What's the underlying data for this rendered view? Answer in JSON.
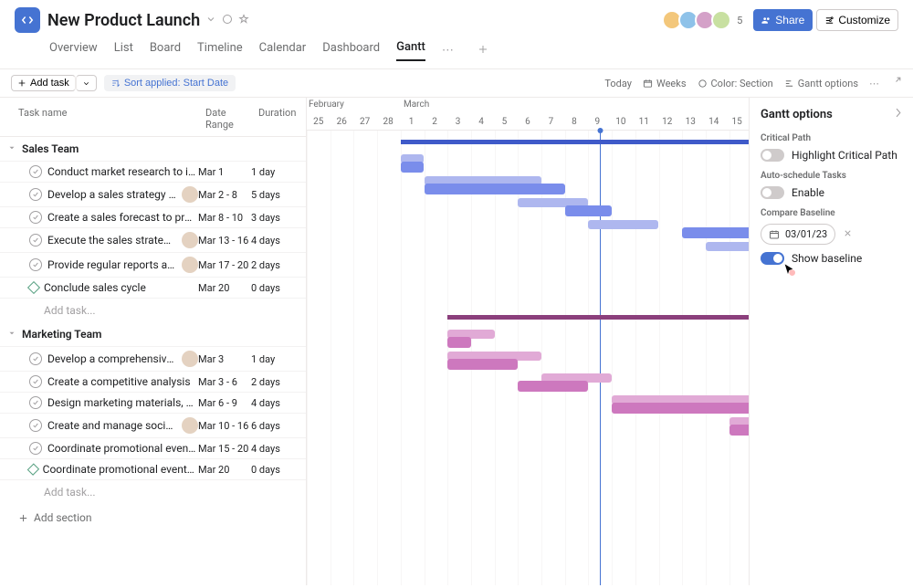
{
  "header": {
    "title": "New Product Launch",
    "share_label": "Share",
    "customize_label": "Customize",
    "avatar_extra": "5"
  },
  "nav": {
    "items": [
      "Overview",
      "List",
      "Board",
      "Timeline",
      "Calendar",
      "Dashboard",
      "Gantt"
    ],
    "active_index": 6
  },
  "toolbar": {
    "add_task": "Add task",
    "sort_label": "Sort applied: Start Date",
    "today": "Today",
    "weeks": "Weeks",
    "color": "Color: Section",
    "gantt_options": "Gantt options"
  },
  "columns": {
    "task": "Task name",
    "date": "Date Range",
    "duration": "Duration"
  },
  "timeline": {
    "months": [
      {
        "label": "February",
        "pos": 2
      },
      {
        "label": "March",
        "pos": 106
      }
    ],
    "days": [
      "25",
      "26",
      "27",
      "28",
      "1",
      "2",
      "3",
      "4",
      "5",
      "6",
      "7",
      "8",
      "9",
      "10",
      "11",
      "12",
      "13",
      "14",
      "15"
    ],
    "cell_width": 25.7,
    "today_index": 12.5
  },
  "sections": [
    {
      "name": "Sales Team",
      "color": "sales",
      "section_bar_start": 4,
      "section_bar_end": 25,
      "tasks": [
        {
          "name": "Conduct market research to identify...",
          "date": "Mar 1",
          "dur": "1 day",
          "avatar": false,
          "bar_start": 4,
          "bar_end": 5,
          "base_start": 4,
          "base_end": 5
        },
        {
          "name": "Develop a sales strategy that...",
          "date": "Mar 2 - 8",
          "dur": "5 days",
          "avatar": true,
          "bar_start": 5,
          "bar_end": 11,
          "base_start": 5,
          "base_end": 10
        },
        {
          "name": "Create a sales forecast to project...",
          "date": "Mar 8 - 10",
          "dur": "3 days",
          "avatar": false,
          "bar_start": 11,
          "bar_end": 13,
          "base_start": 9,
          "base_end": 12
        },
        {
          "name": "Execute the sales strategy by...",
          "date": "Mar 13 - 16",
          "dur": "4 days",
          "avatar": true,
          "bar_start": 16,
          "bar_end": 19,
          "base_start": 12,
          "base_end": 15
        },
        {
          "name": "Provide regular reports and...",
          "date": "Mar 17 - 20",
          "dur": "2 days",
          "avatar": true,
          "bar_start": 20,
          "bar_end": 22,
          "base_start": 17,
          "base_end": 19
        },
        {
          "name": "Conclude sales cycle",
          "date": "Mar 20",
          "dur": "0 days",
          "avatar": false,
          "milestone": true
        }
      ],
      "add_label": "Add task..."
    },
    {
      "name": "Marketing Team",
      "color": "mkt",
      "section_bar_start": 6,
      "section_bar_end": 25,
      "tasks": [
        {
          "name": "Develop a comprehensive...",
          "date": "Mar 3",
          "dur": "1 day",
          "avatar": true,
          "bar_start": 6,
          "bar_end": 7,
          "base_start": 6,
          "base_end": 8
        },
        {
          "name": "Create a competitive analysis",
          "date": "Mar 3 - 6",
          "dur": "2 days",
          "avatar": false,
          "bar_start": 6,
          "bar_end": 9,
          "base_start": 6,
          "base_end": 10
        },
        {
          "name": "Design marketing materials, such as...",
          "date": "Mar 6 - 9",
          "dur": "4 days",
          "avatar": false,
          "bar_start": 9,
          "bar_end": 12,
          "base_start": 10,
          "base_end": 13
        },
        {
          "name": "Create and manage social media...",
          "date": "Mar 10 - 16",
          "dur": "6 days",
          "avatar": true,
          "bar_start": 13,
          "bar_end": 19,
          "base_start": 13,
          "base_end": 19
        },
        {
          "name": "Coordinate promotional events,...",
          "date": "Mar 15 - 20",
          "dur": "4 days",
          "avatar": false,
          "bar_start": 18,
          "bar_end": 22,
          "base_start": 18,
          "base_end": 23
        },
        {
          "name": "Coordinate promotional events, such...",
          "date": "Mar 20",
          "dur": "0 days",
          "avatar": false,
          "milestone": true
        }
      ],
      "add_label": "Add task..."
    }
  ],
  "add_section_label": "Add section",
  "panel": {
    "title": "Gantt options",
    "critical_path_label": "Critical Path",
    "highlight_label": "Highlight Critical Path",
    "auto_schedule_label": "Auto-schedule Tasks",
    "enable_label": "Enable",
    "compare_label": "Compare Baseline",
    "baseline_date": "03/01/23",
    "show_baseline_label": "Show baseline"
  }
}
